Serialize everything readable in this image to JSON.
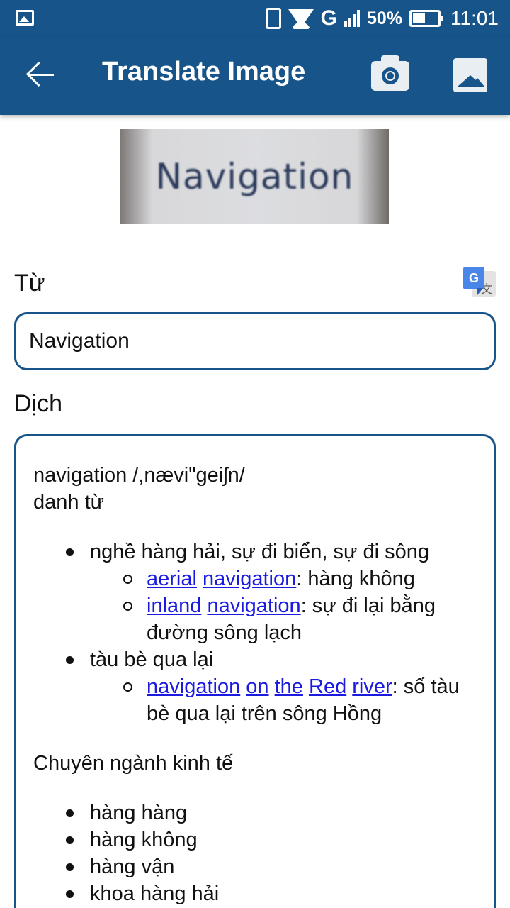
{
  "status_bar": {
    "network": "G",
    "battery_percent": "50%",
    "battery_level": 0.5,
    "time": "11:01"
  },
  "app_bar": {
    "title": "Translate Image",
    "icons": [
      "back-arrow-icon",
      "camera-icon",
      "gallery-icon"
    ]
  },
  "preview": {
    "text": "Navigation"
  },
  "from": {
    "label": "Từ",
    "value": "Navigation"
  },
  "to": {
    "label": "Dịch"
  },
  "result": {
    "headword": "navigation /,nævi\"geiʃn/",
    "pos": "danh từ",
    "senses": [
      {
        "text": "nghề hàng hải, sự đi biển, sự đi sông",
        "examples": [
          {
            "links": [
              "aerial",
              "navigation"
            ],
            "rest": ": hàng không"
          },
          {
            "links": [
              "inland",
              "navigation"
            ],
            "rest": ": sự đi lại bằng đường sông lạch"
          }
        ]
      },
      {
        "text": "tàu bè qua lại",
        "examples": [
          {
            "links": [
              "navigation",
              "on",
              "the",
              "Red",
              "river"
            ],
            "rest": ": số tàu bè qua lại trên sông Hồng"
          }
        ]
      }
    ],
    "section_title": "Chuyên ngành kinh tế",
    "section_items": [
      "hàng hàng",
      "hàng không",
      "hàng vận",
      "khoa hàng hải"
    ]
  }
}
